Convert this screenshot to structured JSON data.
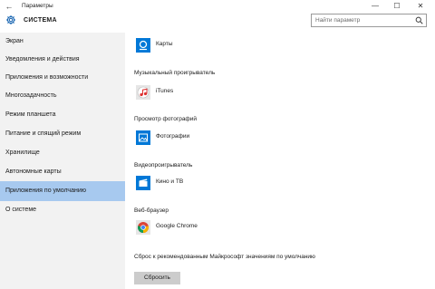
{
  "window": {
    "title": "Параметры",
    "back_glyph": "←",
    "minimize_glyph": "—",
    "maximize_glyph": "☐",
    "close_glyph": "✕"
  },
  "header": {
    "title": "СИСТЕМА",
    "search_placeholder": "Найти параметр"
  },
  "sidebar": {
    "items": [
      {
        "label": "Экран"
      },
      {
        "label": "Уведомления и действия"
      },
      {
        "label": "Приложения и возможности"
      },
      {
        "label": "Многозадачность"
      },
      {
        "label": "Режим планшета"
      },
      {
        "label": "Питание и спящий режим"
      },
      {
        "label": "Хранилище"
      },
      {
        "label": "Автономные карты"
      },
      {
        "label": "Приложения по умолчанию",
        "active": true
      },
      {
        "label": "О системе"
      }
    ],
    "active_color": "#a7c9ef"
  },
  "main": {
    "maps": {
      "app": "Карты",
      "icon": "maps-icon"
    },
    "music": {
      "category": "Музыкальный проигрыватель",
      "app": "iTunes",
      "icon": "itunes-icon"
    },
    "photos": {
      "category": "Просмотр фотографий",
      "app": "Фотографии",
      "icon": "photos-icon"
    },
    "video": {
      "category": "Видеопроигрыватель",
      "app": "Кино и ТВ",
      "icon": "movies-tv-icon"
    },
    "browser": {
      "category": "Веб-браузер",
      "app": "Google Chrome",
      "icon": "chrome-icon"
    },
    "reset": {
      "text": "Сброс к рекомендованным Майкрософт значениям по умолчанию",
      "button": "Сбросить"
    },
    "accent_color": "#0078d7"
  }
}
